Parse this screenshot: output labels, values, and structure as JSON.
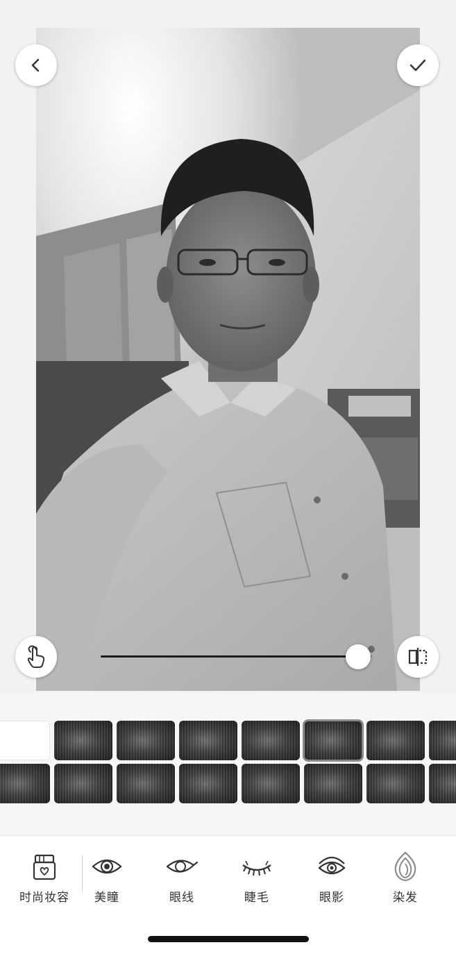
{
  "photo": {
    "slider_value": 0.95,
    "icons": {
      "back": "chevron-left-icon",
      "confirm": "checkmark-icon",
      "touch": "hand-touch-icon",
      "compare": "compare-split-icon"
    }
  },
  "swatches": {
    "row1": [
      "none",
      "hair-1",
      "hair-2",
      "hair-3",
      "hair-4",
      "hair-5",
      "hair-6",
      "hair-7"
    ],
    "row2": [
      "hair-8",
      "hair-9",
      "hair-10",
      "hair-11",
      "hair-12",
      "hair-13",
      "hair-14",
      "hair-15"
    ],
    "selected_row1_index": 5
  },
  "toolbar": {
    "tools": [
      {
        "label": "时尚妆容",
        "icon": "makeup-kit-icon"
      },
      {
        "label": "美瞳",
        "icon": "contact-lens-eye-icon"
      },
      {
        "label": "眼线",
        "icon": "eyeliner-icon"
      },
      {
        "label": "睫毛",
        "icon": "eyelash-icon"
      },
      {
        "label": "眼影",
        "icon": "eyeshadow-icon"
      },
      {
        "label": "染发",
        "icon": "hair-dye-icon"
      }
    ]
  },
  "colors": {
    "background": "#f5f5f5",
    "text": "#333333",
    "home_indicator": "#111111"
  }
}
